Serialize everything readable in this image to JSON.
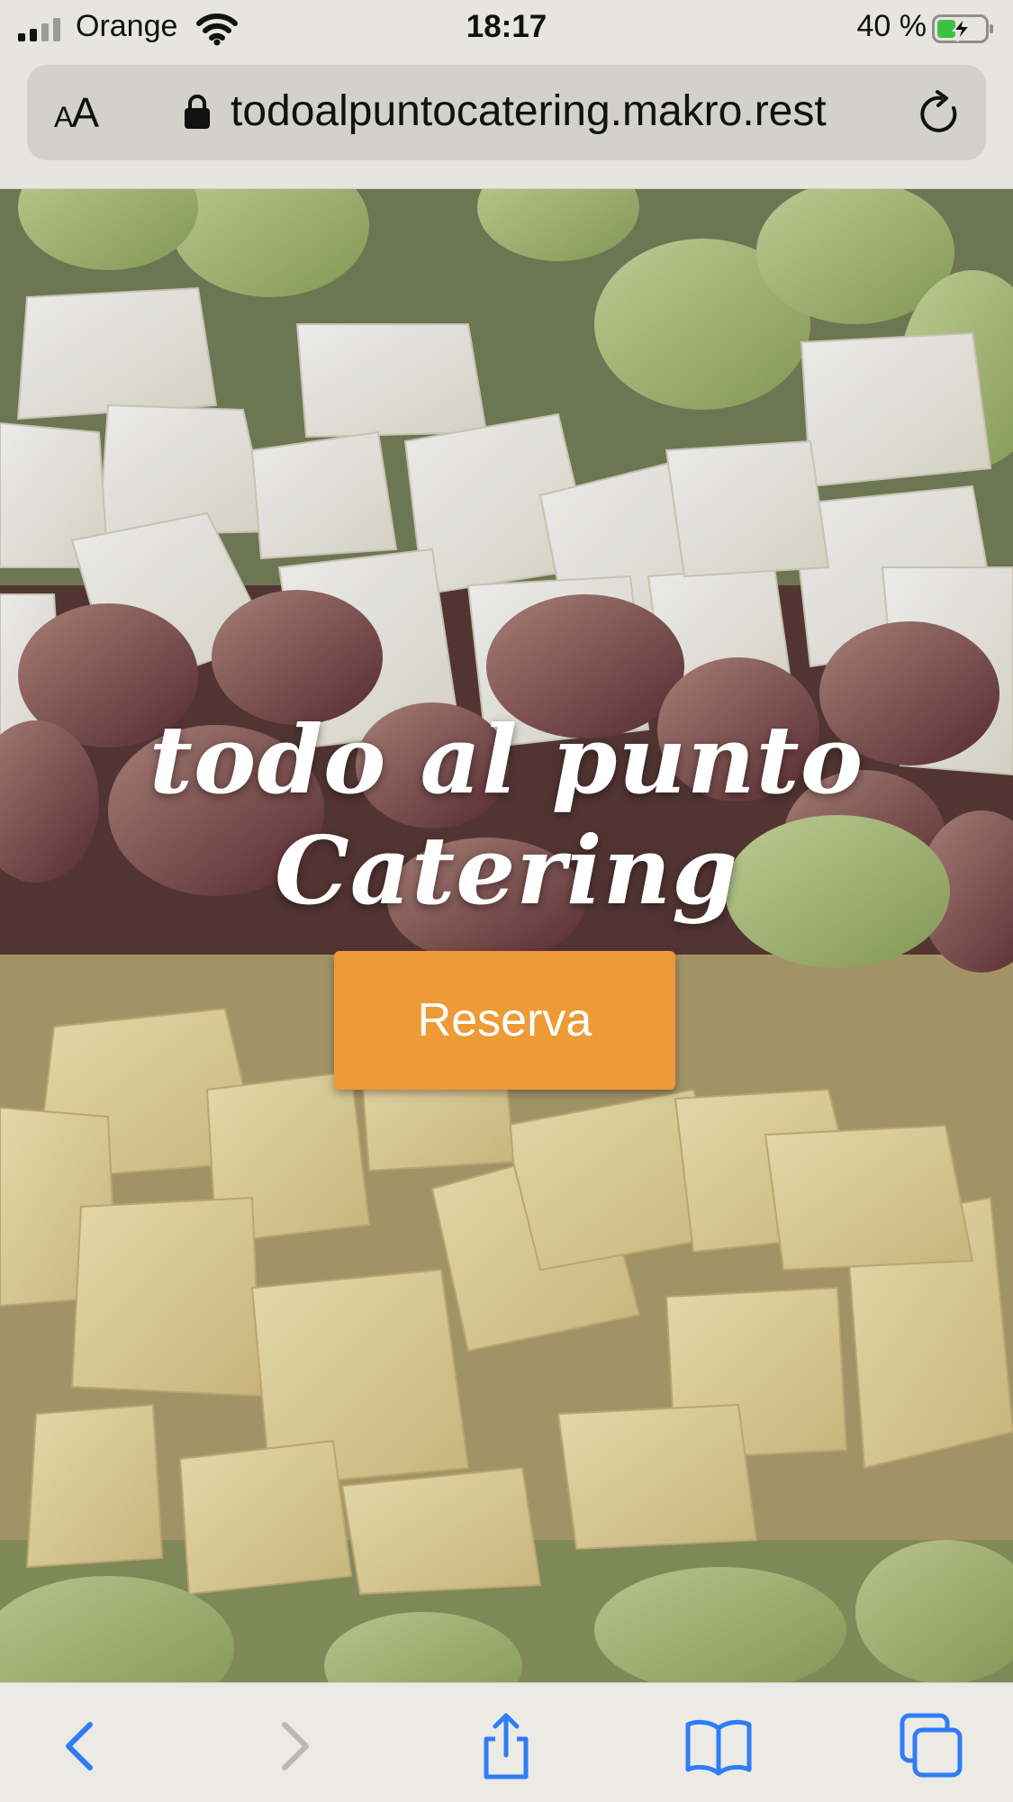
{
  "status_bar": {
    "carrier": "Orange",
    "time": "18:17",
    "battery_percent": "40 %",
    "battery_level": 0.4
  },
  "url_bar": {
    "text_size_label": "AA",
    "url": "todoalpuntocatering.makro.rest"
  },
  "hero": {
    "title": "todo al punto Catering",
    "cta_label": "Reserva",
    "cta_color": "#ee9a36"
  },
  "toolbar": {
    "icons": [
      "back-icon",
      "forward-icon",
      "share-icon",
      "bookmarks-icon",
      "tabs-icon"
    ],
    "accent_color": "#2f7cf6",
    "disabled_color": "#b9b8b4"
  }
}
